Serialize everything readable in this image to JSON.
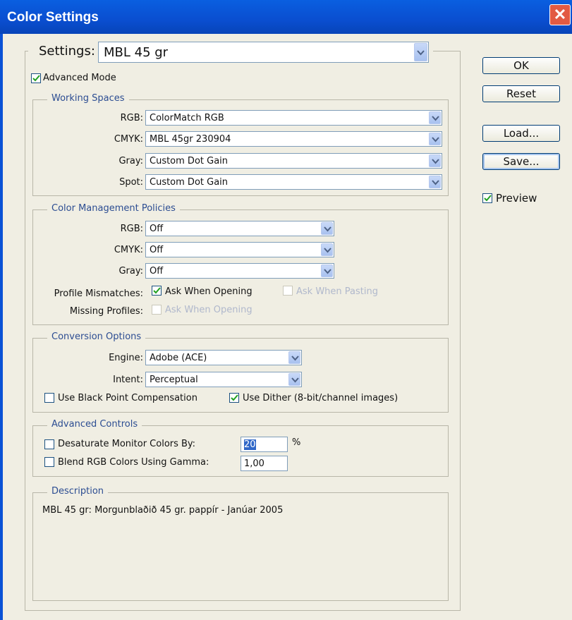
{
  "window": {
    "title": "Color Settings",
    "close_glyph": "✕"
  },
  "settings": {
    "label": "Settings:",
    "value": "MBL 45 gr"
  },
  "advanced_mode": {
    "label": "Advanced Mode",
    "checked": true
  },
  "working_spaces": {
    "legend": "Working Spaces",
    "rows": [
      {
        "label": "RGB:",
        "value": "ColorMatch RGB"
      },
      {
        "label": "CMYK:",
        "value": "MBL 45gr 230904"
      },
      {
        "label": "Gray:",
        "value": "Custom Dot Gain"
      },
      {
        "label": "Spot:",
        "value": "Custom Dot Gain"
      }
    ]
  },
  "policies": {
    "legend": "Color Management Policies",
    "rows": [
      {
        "label": "RGB:",
        "value": "Off"
      },
      {
        "label": "CMYK:",
        "value": "Off"
      },
      {
        "label": "Gray:",
        "value": "Off"
      }
    ],
    "profile_mismatches": {
      "label": "Profile Mismatches:",
      "ask_opening": "Ask When Opening",
      "ask_pasting": "Ask When Pasting"
    },
    "missing_profiles": {
      "label": "Missing Profiles:",
      "ask_opening": "Ask When Opening"
    }
  },
  "conversion": {
    "legend": "Conversion Options",
    "engine": {
      "label": "Engine:",
      "value": "Adobe (ACE)"
    },
    "intent": {
      "label": "Intent:",
      "value": "Perceptual"
    },
    "black_point": "Use Black Point Compensation",
    "dither": "Use Dither (8-bit/channel images)"
  },
  "advanced_controls": {
    "legend": "Advanced Controls",
    "desaturate": {
      "label": "Desaturate Monitor Colors By:",
      "value": "20",
      "unit": "%"
    },
    "blend": {
      "label": "Blend RGB Colors Using Gamma:",
      "value": "1,00"
    }
  },
  "description": {
    "legend": "Description",
    "text": "MBL 45 gr:  Morgunblaðið 45 gr. pappír - Janúar 2005"
  },
  "buttons": {
    "ok": "OK",
    "reset": "Reset",
    "load": "Load...",
    "save": "Save..."
  },
  "preview": {
    "label": "Preview",
    "checked": true
  },
  "colors": {
    "titlebar": "#0a52d6",
    "legend_text": "#2c4d92",
    "dialog_bg": "#f0eee3",
    "close_button": "#e25a43"
  },
  "icons": {
    "close": "close-icon",
    "dropdown": "chevron-down-icon",
    "check": "check-icon"
  }
}
